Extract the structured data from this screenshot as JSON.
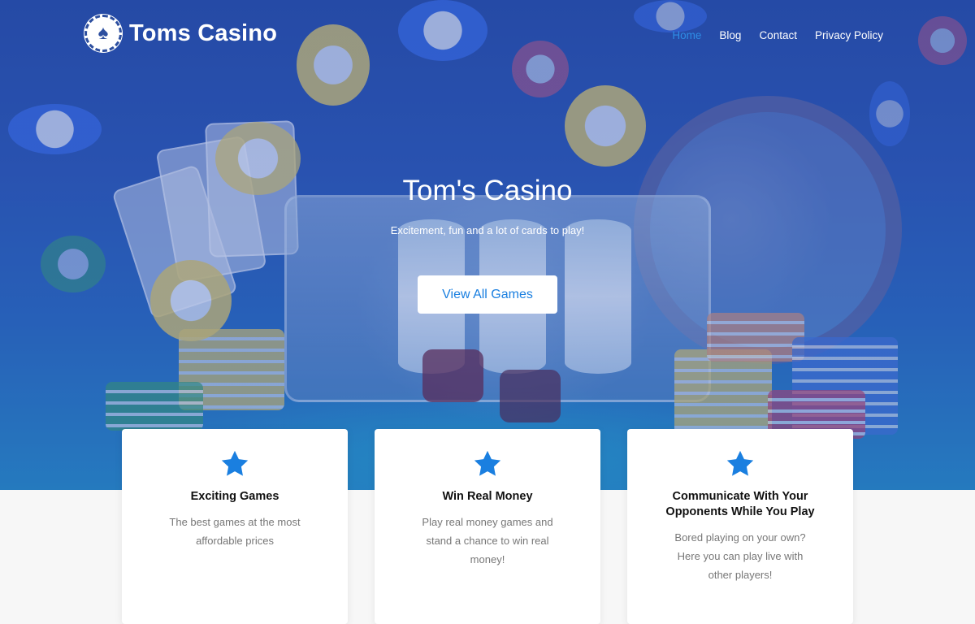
{
  "brand": {
    "name": "Toms Casino",
    "logo_icon": "spade-chip-icon"
  },
  "nav": {
    "items": [
      {
        "label": "Home",
        "active": true
      },
      {
        "label": "Blog",
        "active": false
      },
      {
        "label": "Contact",
        "active": false
      },
      {
        "label": "Privacy Policy",
        "active": false
      }
    ]
  },
  "hero": {
    "title": "Tom's Casino",
    "subtitle": "Excitement, fun and a lot of cards to play!",
    "cta_label": "View All Games"
  },
  "features": [
    {
      "icon": "star-icon",
      "title": "Exciting Games",
      "text": "The best games at the most affordable prices"
    },
    {
      "icon": "star-icon",
      "title": "Win Real Money",
      "text": "Play real money games and stand a chance to win real money!"
    },
    {
      "icon": "star-icon",
      "title": "Communicate With Your Opponents While You Play",
      "text": "Bored playing on your own? Here you can play live with other players!"
    }
  ],
  "colors": {
    "accent": "#1a7fe0",
    "nav_active": "#2e8de6",
    "star": "#1a7fe0",
    "hero_base": "#2f5ab6"
  }
}
